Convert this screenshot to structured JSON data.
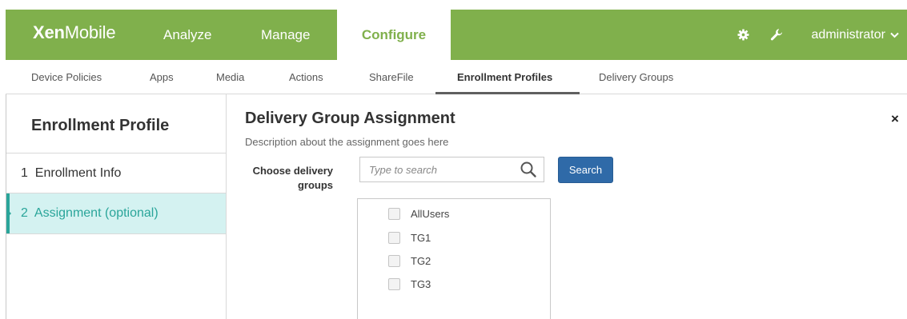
{
  "app": {
    "logo_bold": "Xen",
    "logo_light": "Mobile"
  },
  "topnav": {
    "tabs": [
      {
        "label": "Analyze"
      },
      {
        "label": "Manage"
      },
      {
        "label": "Configure"
      }
    ],
    "active_tab": "Configure",
    "user": "administrator",
    "icons": [
      "gear-icon",
      "wrench-icon",
      "chevron-down-icon"
    ]
  },
  "subnav": {
    "items": [
      {
        "label": "Device Policies"
      },
      {
        "label": "Apps"
      },
      {
        "label": "Media"
      },
      {
        "label": "Actions"
      },
      {
        "label": "ShareFile"
      },
      {
        "label": "Enrollment Profiles"
      },
      {
        "label": "Delivery Groups"
      }
    ],
    "active": "Enrollment Profiles"
  },
  "sidebar": {
    "title": "Enrollment Profile",
    "steps": [
      {
        "number": "1",
        "label": "Enrollment Info"
      },
      {
        "number": "2",
        "label": "Assignment (optional)"
      }
    ],
    "active_step": "2"
  },
  "main": {
    "title": "Delivery Group Assignment",
    "description": "Description about the assignment goes here",
    "close_symbol": "×",
    "field_label_line1": "Choose delivery",
    "field_label_line2": "groups",
    "search": {
      "placeholder": "Type to search",
      "value": "",
      "button_label": "Search"
    },
    "groups": [
      {
        "label": "AllUsers",
        "checked": false
      },
      {
        "label": "TG1",
        "checked": false
      },
      {
        "label": "TG2",
        "checked": false
      },
      {
        "label": "TG3",
        "checked": false
      }
    ]
  },
  "colors": {
    "brand_green": "#80b04c",
    "active_step_bg": "#d4f2f1",
    "active_step_text": "#2aa59a",
    "search_button": "#2f6aa8"
  }
}
